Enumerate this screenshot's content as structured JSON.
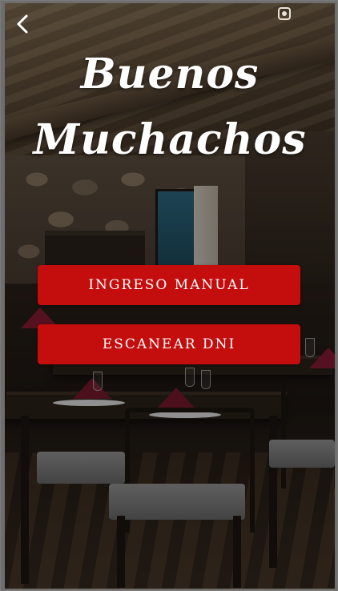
{
  "header": {
    "back_icon": "chevron-left-icon",
    "status_icon": "status-icon"
  },
  "brand": {
    "line1": "Buenos",
    "line2": "Muchachos"
  },
  "actions": {
    "manual_label": "INGRESO MANUAL",
    "scan_label": "ESCANEAR DNI"
  },
  "colors": {
    "button": "#c40d0d",
    "text": "#ffffff"
  }
}
